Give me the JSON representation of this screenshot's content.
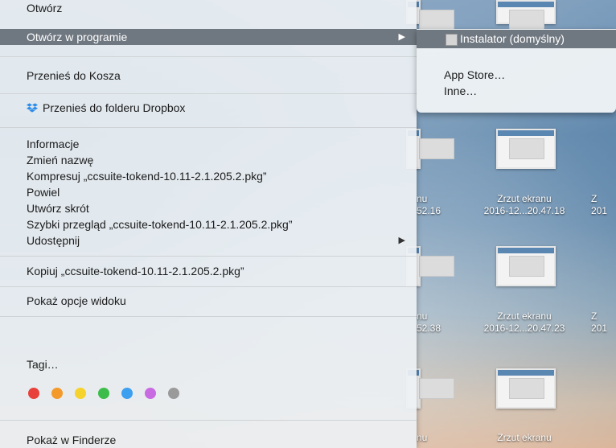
{
  "menu": {
    "open": "Otwórz",
    "open_with": "Otwórz w programie",
    "trash": "Przenieś do Kosza",
    "dropbox": "Przenieś do folderu Dropbox",
    "info": "Informacje",
    "rename": "Zmień nazwę",
    "compress": "Kompresuj „ccsuite-tokend-10.11-2.1.205.2.pkg”",
    "duplicate": "Powiel",
    "alias": "Utwórz skrót",
    "quicklook": "Szybki przegląd „ccsuite-tokend-10.11-2.1.205.2.pkg”",
    "share": "Udostępnij",
    "copy": "Kopiuj „ccsuite-tokend-10.11-2.1.205.2.pkg”",
    "view_options": "Pokaż opcje widoku",
    "tags": "Tagi…",
    "show_finder": "Pokaż w Finderze"
  },
  "tag_colors": [
    "#e8413b",
    "#f39a2a",
    "#f5d22c",
    "#3cbd4b",
    "#3d9ff0",
    "#c86be2",
    "#9a9a9a"
  ],
  "submenu": {
    "installer": "Instalator (domyślny)",
    "app_store": "App Store…",
    "other": "Inne…"
  },
  "desktop": {
    "labels": [
      {
        "line1": "nu",
        "line2": "52.16"
      },
      {
        "line1": "Zrzut ekranu",
        "line2": "2016-12...20.47.18"
      },
      {
        "line1": "Z",
        "line2": "201"
      },
      {
        "line1": "nu",
        "line2": "52.38"
      },
      {
        "line1": "Zrzut ekranu",
        "line2": "2016-12...20.47.23"
      },
      {
        "line1": "Z",
        "line2": "201"
      },
      {
        "line1": "nu",
        "line2": ""
      },
      {
        "line1": "Zrzut ekranu",
        "line2": ""
      }
    ]
  }
}
